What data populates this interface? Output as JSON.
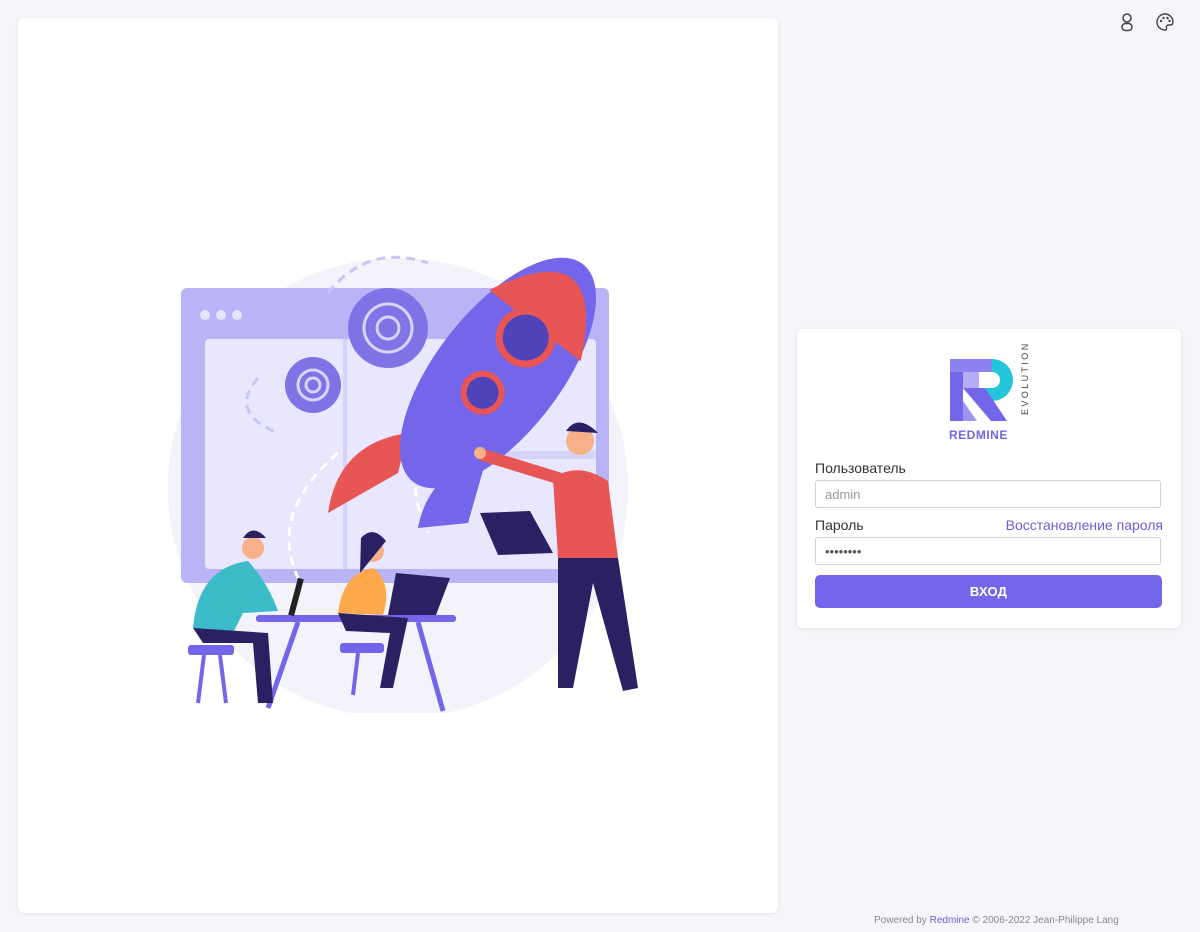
{
  "top_bar": {
    "user_icon": "user-icon",
    "theme_icon": "palette-icon"
  },
  "login": {
    "logo_brand": "REDMINE",
    "logo_sub": "EVOLUTION",
    "username_label": "Пользователь",
    "username_placeholder": "admin",
    "username_value": "",
    "password_label": "Пароль",
    "forgot_link": "Восстановление пароля",
    "password_value": "pwdpwdpw",
    "submit_label": "ВХОД"
  },
  "footer": {
    "prefix": "Powered by",
    "link": "Redmine",
    "suffix": "© 2006-2022 Jean-Philippe Lang"
  },
  "colors": {
    "accent": "#7466ea",
    "rocket_red": "#e85555",
    "background": "#f6f6fa"
  }
}
